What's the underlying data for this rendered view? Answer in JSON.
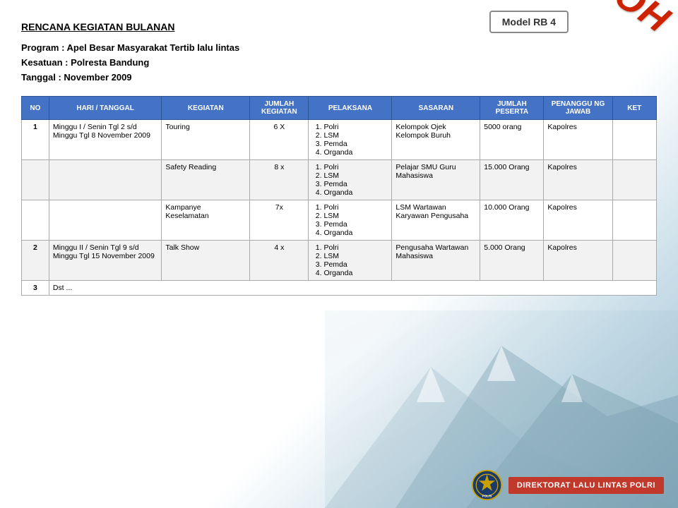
{
  "watermark": "CONTOH",
  "model_box": "Model RB 4",
  "header": {
    "title": "RENCANA KEGIATAN BULANAN",
    "program": "Program  : Apel Besar Masyarakat Tertib lalu lintas",
    "kesatuan": "Kesatuan : Polresta Bandung",
    "tanggal": "Tanggal   : November 2009"
  },
  "table": {
    "columns": [
      "NO",
      "HARI / TANGGAL",
      "KEGIATAN",
      "JUMLAH KEGIATAN",
      "PELAKSANA",
      "SASARAN",
      "JUMLAH PESERTA",
      "PENANGGU NG JAWAB",
      "KET"
    ],
    "rows": [
      {
        "no": "1",
        "hari": "Minggu I / Senin Tgl 2 s/d Minggu Tgl 8 November 2009",
        "kegiatan": "Touring",
        "jumlah": "6 X",
        "pelaksana": [
          "Polri",
          "LSM",
          "Pemda",
          "Organda"
        ],
        "sasaran": "Kelompok Ojek Kelompok Buruh",
        "jumlah_peserta": "5000 orang",
        "penanggung_jawab": "Kapolres",
        "ket": ""
      },
      {
        "no": "",
        "hari": "",
        "kegiatan": "Safety Reading",
        "jumlah": "8 x",
        "pelaksana": [
          "Polri",
          "LSM",
          "Pemda",
          "Organda"
        ],
        "sasaran": "Pelajar SMU Guru Mahasiswa",
        "jumlah_peserta": "15.000 Orang",
        "penanggung_jawab": "Kapolres",
        "ket": ""
      },
      {
        "no": "",
        "hari": "",
        "kegiatan": "Kampanye Keselamatan",
        "jumlah": "7x",
        "pelaksana": [
          "Polri",
          "LSM",
          "Pemda",
          "Organda"
        ],
        "sasaran": "LSM Wartawan Karyawan Pengusaha",
        "jumlah_peserta": "10.000 Orang",
        "penanggung_jawab": "Kapolres",
        "ket": ""
      },
      {
        "no": "2",
        "hari": "Minggu II / Senin Tgl 9 s/d Minggu Tgl 15 November 2009",
        "kegiatan": "Talk Show",
        "jumlah": "4 x",
        "pelaksana": [
          "Polri",
          "LSM",
          "Pemda",
          "Organda"
        ],
        "sasaran": "Pengusaha Wartawan Mahasiswa",
        "jumlah_peserta": "5.000 Orang",
        "penanggung_jawab": "Kapolres",
        "ket": ""
      },
      {
        "no": "3",
        "hari": "Dst ...",
        "kegiatan": "",
        "jumlah": "",
        "pelaksana": [],
        "sasaran": "",
        "jumlah_peserta": "",
        "penanggung_jawab": "",
        "ket": ""
      }
    ]
  },
  "footer": {
    "logo_alt": "Polri Logo",
    "text": "DIREKTORAT LALU LINTAS POLRI"
  }
}
